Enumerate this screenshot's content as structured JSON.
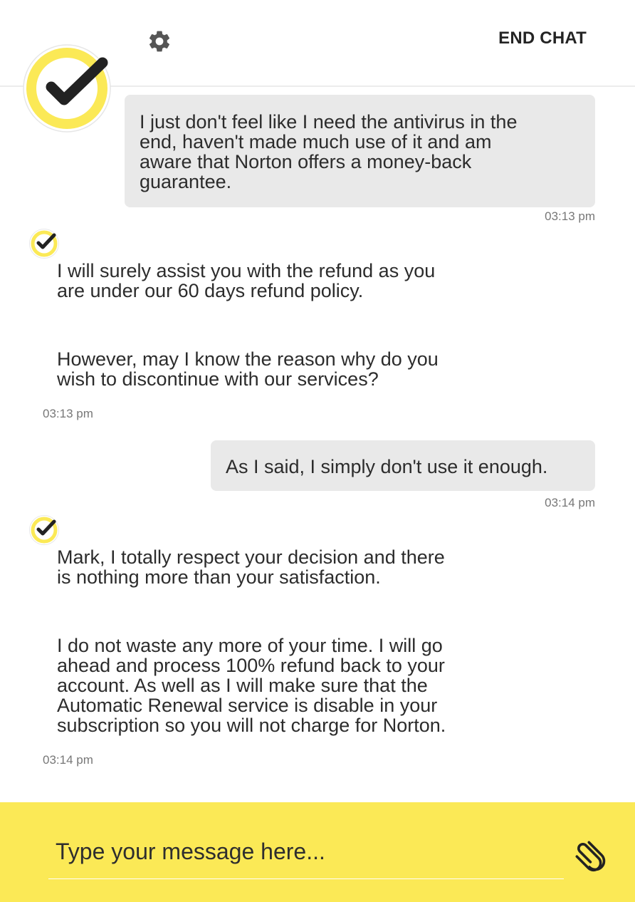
{
  "header": {
    "end_chat_label": "END CHAT",
    "settings_icon": "gear-icon",
    "logo_icon": "norton-checkmark-logo",
    "brand_color": "#fbe956"
  },
  "messages": [
    {
      "sender": "user",
      "lines": [
        "I just don't feel like I need the antivirus in the",
        "end, haven't made much use of it and am",
        "aware that Norton offers a money-back",
        "guarantee."
      ],
      "time": "03:13 pm"
    },
    {
      "sender": "agent",
      "paragraphs": [
        [
          "I will surely assist you with the refund as you",
          "are under our 60 days refund policy."
        ],
        [
          "However, may I know the reason why do you",
          "wish to discontinue with our services?"
        ]
      ],
      "time": "03:13 pm"
    },
    {
      "sender": "user",
      "lines": [
        "As I said, I simply don't use it enough."
      ],
      "time": "03:14 pm"
    },
    {
      "sender": "agent",
      "paragraphs": [
        [
          "Mark, I totally respect your decision and there",
          "is nothing more than your satisfaction."
        ],
        [
          "I do not waste any more of your time. I will go",
          "ahead and process 100% refund back to your",
          "account. As well as I will make sure that the",
          "Automatic Renewal service is disable in your",
          "subscription so you will not charge for Norton."
        ]
      ],
      "time": "03:14 pm"
    }
  ],
  "composer": {
    "placeholder": "Type your message here...",
    "value": "",
    "attach_icon": "paperclip-icon"
  }
}
